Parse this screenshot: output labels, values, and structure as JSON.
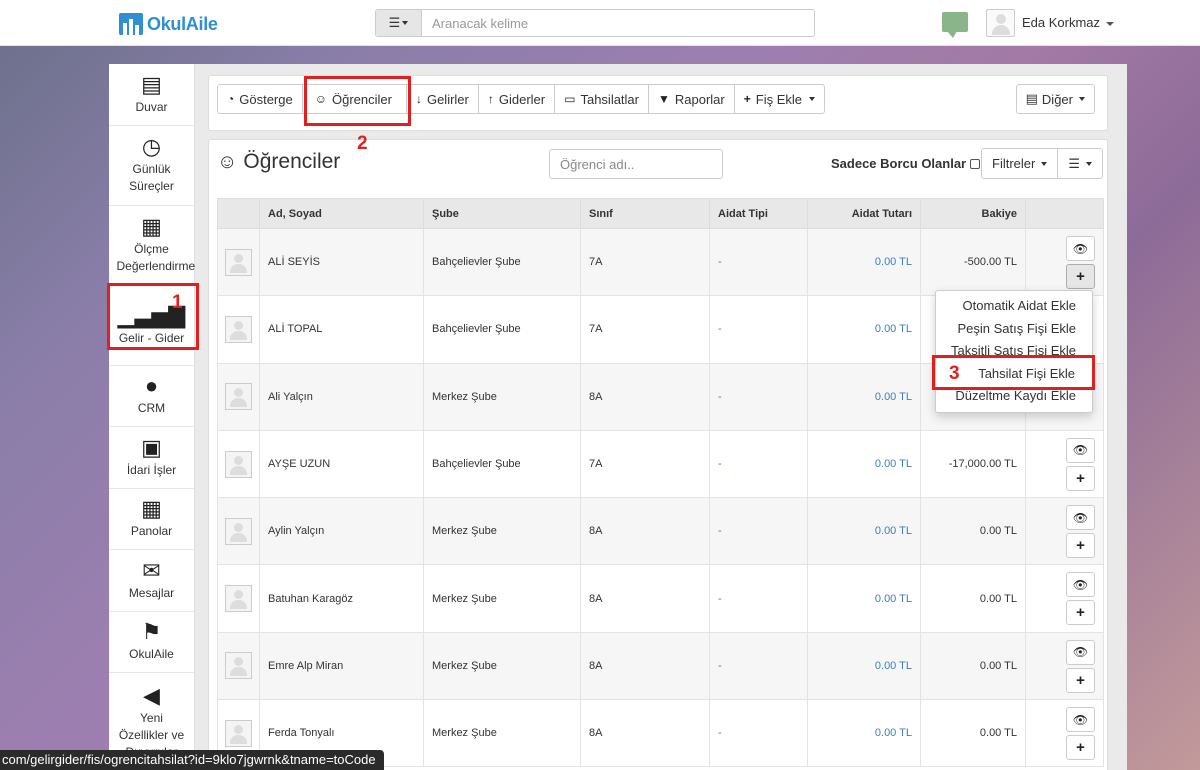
{
  "header": {
    "logo_text": "OkulAile",
    "search_placeholder": "Aranacak kelime",
    "user_name": "Eda Korkmaz"
  },
  "sidebar": {
    "items": [
      {
        "label": "Duvar",
        "icon": "wall-icon"
      },
      {
        "label": "Günlük Süreçler",
        "icon": "clock-icon"
      },
      {
        "label": "Ölçme Değerlendirme",
        "icon": "measurement-icon"
      },
      {
        "label": "Gelir - Gider",
        "icon": "chart-up-icon"
      },
      {
        "label": "CRM",
        "icon": "crm-chat-icon"
      },
      {
        "label": "İdari İşler",
        "icon": "briefcase-icon"
      },
      {
        "label": "Panolar",
        "icon": "calendar-board-icon"
      },
      {
        "label": "Mesajlar",
        "icon": "envelope-icon"
      },
      {
        "label": "OkulAile",
        "icon": "family-icon"
      },
      {
        "label": "Yeni Özellikler ve Duyurular",
        "icon": "megaphone-icon"
      }
    ]
  },
  "toolbar": {
    "buttons": [
      "Gösterge",
      "Öğrenciler",
      "Gelirler",
      "Giderler",
      "Tahsilatlar",
      "Raporlar",
      "Fiş Ekle"
    ],
    "other": "Diğer"
  },
  "content": {
    "title": "Öğrenciler",
    "search_placeholder": "Öğrenci adı..",
    "only_debtors_label": "Sadece Borcu Olanlar",
    "filters_label": "Filtreler"
  },
  "table": {
    "headers": [
      "",
      "Ad, Soyad",
      "Şube",
      "Sınıf",
      "Aidat Tipi",
      "Aidat Tutarı",
      "Bakiye",
      ""
    ],
    "rows": [
      {
        "name": "ALİ SEYİS",
        "branch": "Bahçelievler Şube",
        "class": "7A",
        "fee_type": "-",
        "fee": "0.00 TL",
        "balance": "-500.00 TL"
      },
      {
        "name": "ALİ TOPAL",
        "branch": "Bahçelievler Şube",
        "class": "7A",
        "fee_type": "-",
        "fee": "0.00 TL",
        "balance": ""
      },
      {
        "name": "Ali Yalçın",
        "branch": "Merkez Şube",
        "class": "8A",
        "fee_type": "-",
        "fee": "0.00 TL",
        "balance": ""
      },
      {
        "name": "AYŞE UZUN",
        "branch": "Bahçelievler Şube",
        "class": "7A",
        "fee_type": "-",
        "fee": "0.00 TL",
        "balance": "-17,000.00 TL"
      },
      {
        "name": "Aylin Yalçın",
        "branch": "Merkez Şube",
        "class": "8A",
        "fee_type": "-",
        "fee": "0.00 TL",
        "balance": "0.00 TL"
      },
      {
        "name": "Batuhan Karagöz",
        "branch": "Merkez Şube",
        "class": "8A",
        "fee_type": "-",
        "fee": "0.00 TL",
        "balance": "0.00 TL"
      },
      {
        "name": "Emre Alp Miran",
        "branch": "Merkez Şube",
        "class": "8A",
        "fee_type": "-",
        "fee": "0.00 TL",
        "balance": "0.00 TL"
      },
      {
        "name": "Ferda Tonyalı",
        "branch": "Merkez Şube",
        "class": "8A",
        "fee_type": "-",
        "fee": "0.00 TL",
        "balance": "0.00 TL"
      }
    ]
  },
  "dropdown": {
    "items": [
      "Otomatik Aidat Ekle",
      "Peşin Satış Fişi Ekle",
      "Taksitli Satış Fişi Ekle",
      "Tahsilat Fişi Ekle",
      "Düzeltme Kaydı Ekle"
    ]
  },
  "annotations": {
    "step1": "1",
    "step2": "2",
    "step3": "3",
    "color": "#e02020"
  },
  "status_url": "com/gelirgider/fis/ogrencitahsilat?id=9klo7jgwrnk&tname=toCode"
}
